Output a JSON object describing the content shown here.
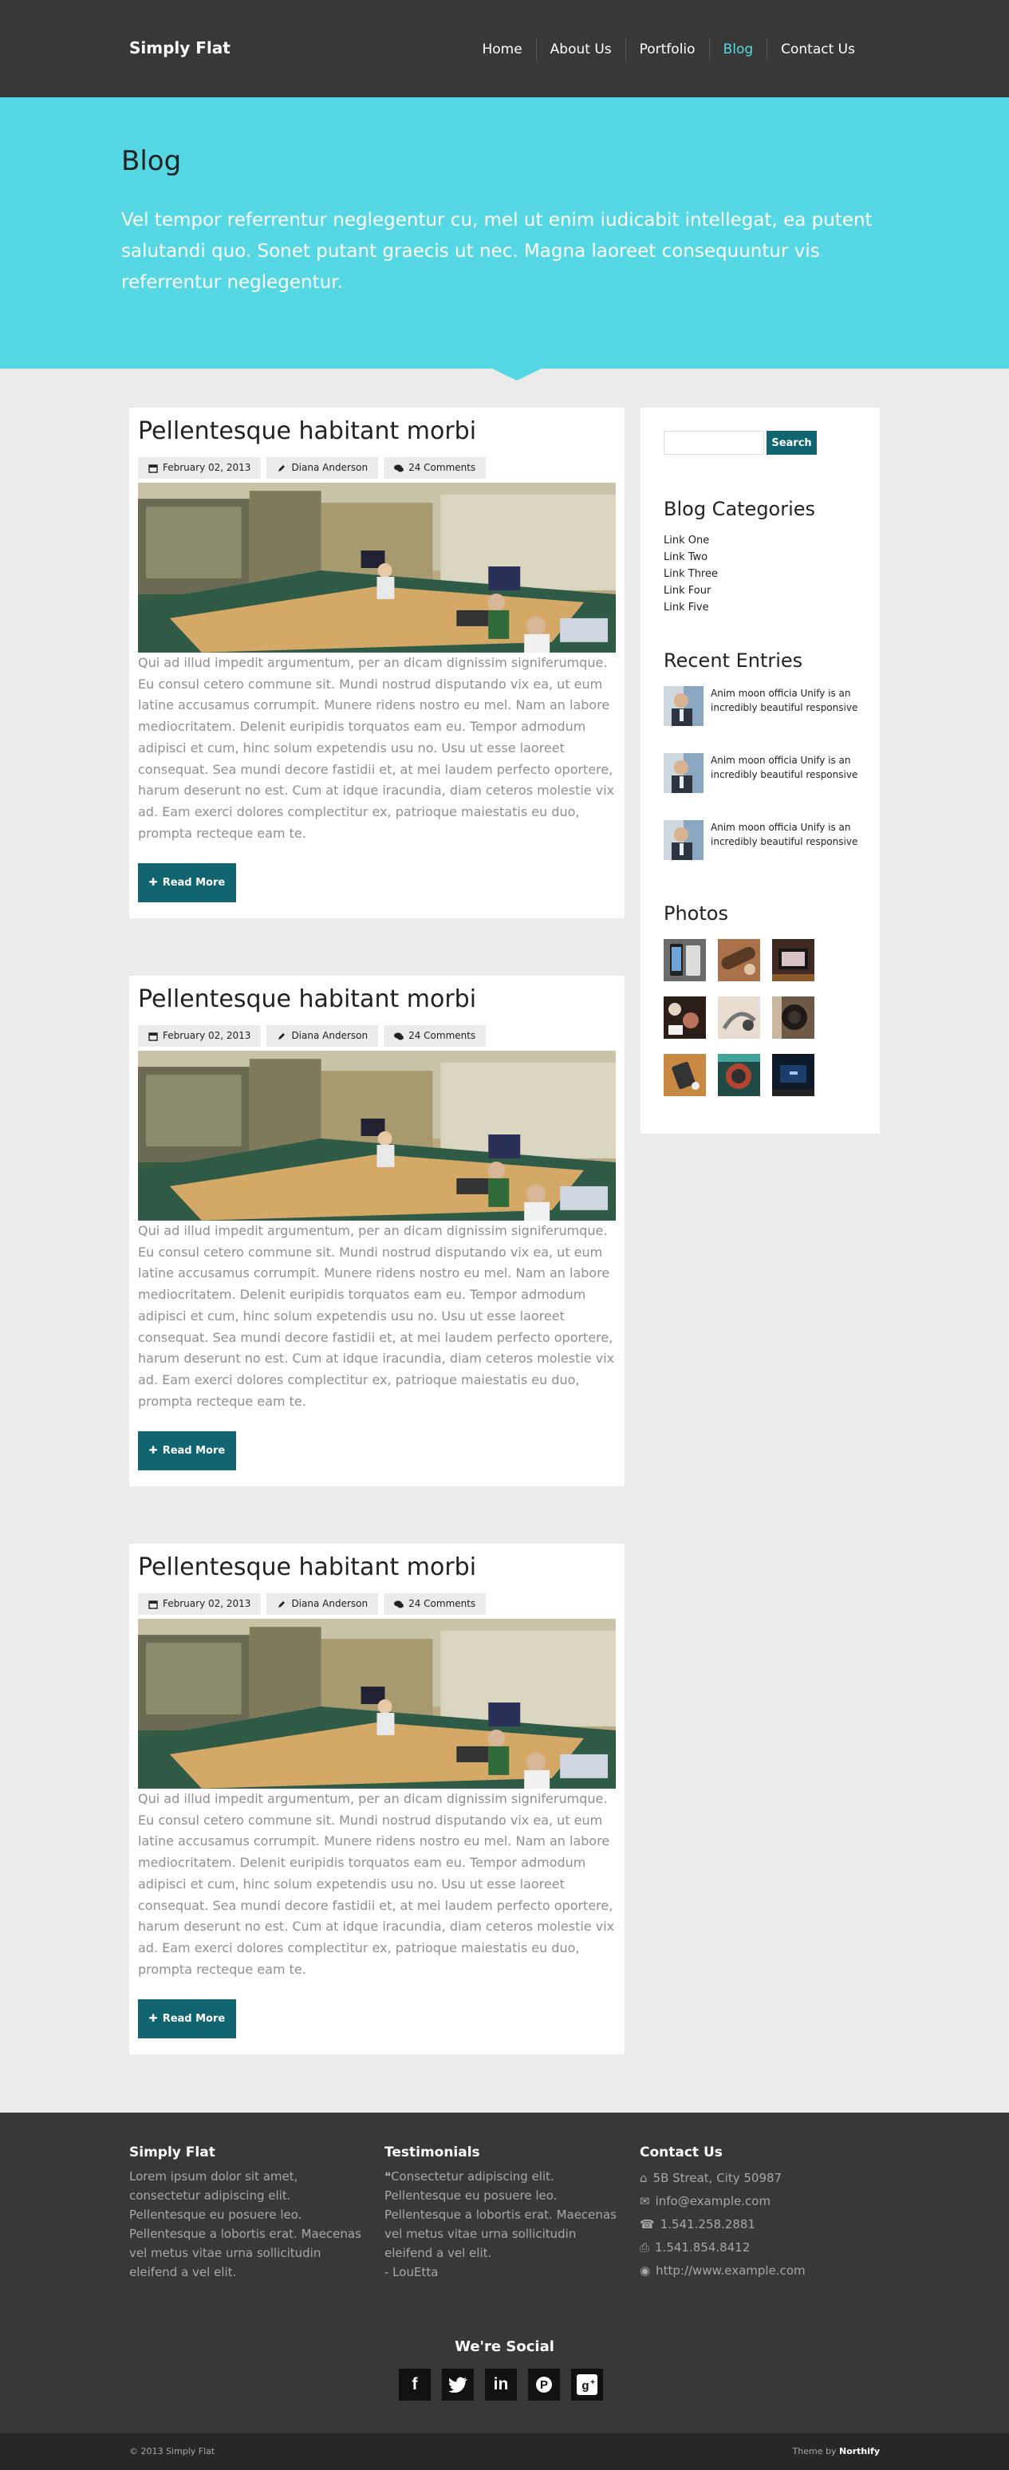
{
  "header": {
    "brand": "Simply Flat",
    "nav": [
      {
        "label": "Home"
      },
      {
        "label": "About Us"
      },
      {
        "label": "Portfolio"
      },
      {
        "label": "Blog",
        "active": true
      },
      {
        "label": "Contact Us"
      }
    ]
  },
  "hero": {
    "title": "Blog",
    "text": "Vel tempor referrentur neglegentur cu, mel ut enim iudicabit intellegat, ea putent salutandi quo. Sonet putant graecis ut nec. Magna laoreet consequuntur vis referrentur neglegentur."
  },
  "posts": [
    {
      "title": "Pellentesque habitant morbi",
      "date": "February 02, 2013",
      "author": "Diana Anderson",
      "comments": "24 Comments",
      "body": "Qui ad illud impedit argumentum, per an dicam dignissim signiferumque. Eu consul cetero commune sit. Mundi nostrud disputando vix ea, ut eum latine accusamus corrumpit. Munere ridens nostro eu mel. Nam an labore mediocritatem. Delenit euripidis torquatos eam eu. Tempor admodum adipisci et cum, hinc solum expetendis usu no. Usu ut esse laoreet consequat. Sea mundi decore fastidii et, at mei laudem perfecto oportere, harum deserunt no est. Cum at idque iracundia, diam ceteros molestie vix ad. Eam exerci dolores complectitur ex, patrioque maiestatis eu duo, prompta recteque eam te.",
      "read_more": "Read More"
    },
    {
      "title": "Pellentesque habitant morbi",
      "date": "February 02, 2013",
      "author": "Diana Anderson",
      "comments": "24 Comments",
      "body": "Qui ad illud impedit argumentum, per an dicam dignissim signiferumque. Eu consul cetero commune sit. Mundi nostrud disputando vix ea, ut eum latine accusamus corrumpit. Munere ridens nostro eu mel. Nam an labore mediocritatem. Delenit euripidis torquatos eam eu. Tempor admodum adipisci et cum, hinc solum expetendis usu no. Usu ut esse laoreet consequat. Sea mundi decore fastidii et, at mei laudem perfecto oportere, harum deserunt no est. Cum at idque iracundia, diam ceteros molestie vix ad. Eam exerci dolores complectitur ex, patrioque maiestatis eu duo, prompta recteque eam te.",
      "read_more": "Read More"
    },
    {
      "title": "Pellentesque habitant morbi",
      "date": "February 02, 2013",
      "author": "Diana Anderson",
      "comments": "24 Comments",
      "body": "Qui ad illud impedit argumentum, per an dicam dignissim signiferumque. Eu consul cetero commune sit. Mundi nostrud disputando vix ea, ut eum latine accusamus corrumpit. Munere ridens nostro eu mel. Nam an labore mediocritatem. Delenit euripidis torquatos eam eu. Tempor admodum adipisci et cum, hinc solum expetendis usu no. Usu ut esse laoreet consequat. Sea mundi decore fastidii et, at mei laudem perfecto oportere, harum deserunt no est. Cum at idque iracundia, diam ceteros molestie vix ad. Eam exerci dolores complectitur ex, patrioque maiestatis eu duo, prompta recteque eam te.",
      "read_more": "Read More"
    }
  ],
  "sidebar": {
    "search_button": "Search",
    "categories_title": "Blog Categories",
    "categories": [
      "Link One",
      "Link Two",
      "Link Three",
      "Link Four",
      "Link Five"
    ],
    "recent_title": "Recent Entries",
    "recent": [
      "Anim moon officia Unify is an incredibly beautiful responsive",
      "Anim moon officia Unify is an incredibly beautiful responsive",
      "Anim moon officia Unify is an incredibly beautiful responsive"
    ],
    "photos_title": "Photos"
  },
  "footer": {
    "about_title": "Simply Flat",
    "about_text": "Lorem ipsum dolor sit amet, consectetur adipiscing elit. Pellentesque eu posuere leo. Pellentesque a lobortis erat. Maecenas vel metus vitae urna sollicitudin eleifend a vel elit.",
    "testimonials_title": "Testimonials",
    "testimonial_text": "Consectetur adipiscing elit. Pellentesque eu posuere leo. Pellentesque a lobortis erat. Maecenas vel metus vitae urna sollicitudin eleifend a vel elit.",
    "testimonial_author": "- LouEtta",
    "contact_title": "Contact Us",
    "address": "5B Streat, City 50987",
    "email": "info@example.com",
    "phone": "1.541.258.2881",
    "fax": "1.541.854.8412",
    "website": "http://www.example.com",
    "social_title": "We're Social",
    "social": [
      "facebook-icon",
      "twitter-icon",
      "linkedin-icon",
      "pinterest-icon",
      "google-plus-icon"
    ],
    "copyright": "© 2013 Simply Flat",
    "theme_by_prefix": "Theme by",
    "theme_by_name": "Northify"
  },
  "colors": {
    "accent": "#56d8e4",
    "button": "#106570",
    "dark": "#383838"
  }
}
